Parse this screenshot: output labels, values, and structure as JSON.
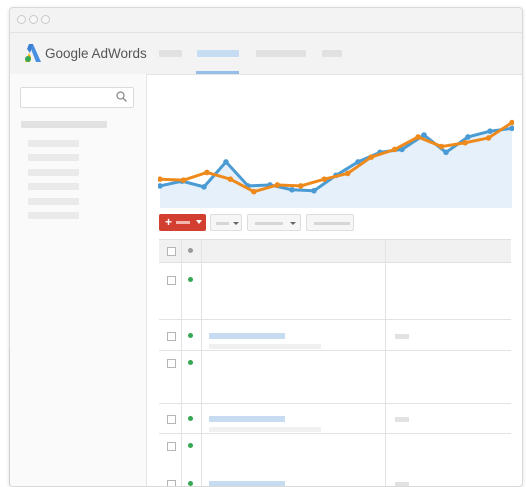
{
  "app": {
    "brand": "Google AdWords"
  },
  "colors": {
    "accent_blue": "#4a9bd4",
    "accent_orange": "#ee8a1c",
    "add_button": "#d23f31",
    "status_enabled": "#35a853"
  },
  "icons": {
    "logo": "adwords-logo-icon",
    "search": "search-icon",
    "add": "plus-icon",
    "dropdown": "chevron-down-icon"
  },
  "add_button": {
    "symbol": "+"
  },
  "chart_data": {
    "type": "line",
    "title": "",
    "xlabel": "",
    "ylabel": "",
    "x": [
      1,
      2,
      3,
      4,
      5,
      6,
      7,
      8,
      9,
      10,
      11,
      12,
      13,
      14,
      15,
      16,
      17,
      18,
      19,
      20
    ],
    "ylim": [
      0,
      100
    ],
    "series": [
      {
        "values": [
          23,
          28,
          22,
          48,
          23,
          24,
          19,
          18,
          34,
          48,
          58,
          61,
          76,
          58,
          74,
          80,
          83
        ]
      },
      {
        "values": [
          30,
          29,
          37,
          30,
          17,
          24,
          23,
          30,
          36,
          53,
          61,
          74,
          64,
          68,
          73,
          89
        ]
      }
    ],
    "grid": false,
    "legend": "none"
  }
}
